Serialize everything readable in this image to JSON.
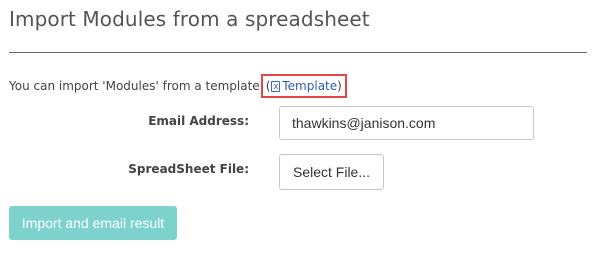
{
  "page": {
    "title": "Import Modules from a spreadsheet"
  },
  "intro": {
    "text": "You can import 'Modules' from a template",
    "paren_open": "(",
    "template_link": "Template",
    "paren_close": ")",
    "template_icon": "excel-file-icon",
    "highlight_color": "#e8454a"
  },
  "form": {
    "email_label": "Email Address:",
    "email_value": "thawkins@janison.com",
    "file_label": "SpreadSheet File:",
    "file_button": "Select File..."
  },
  "actions": {
    "import_button": "Import and email result",
    "import_button_color": "#7dd3cb"
  }
}
